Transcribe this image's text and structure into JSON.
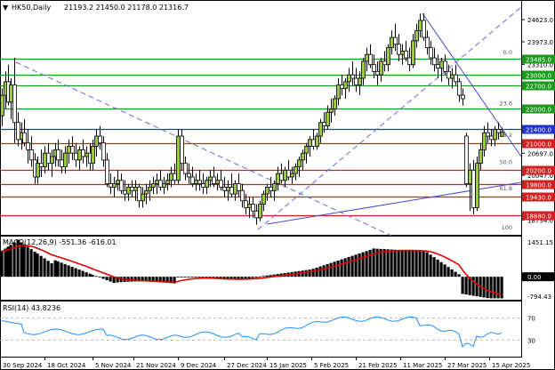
{
  "header": {
    "symbol": "HK50,Daily",
    "ohlc": "21193.2 21450.0 21178.0 21316.7"
  },
  "chart_data": {
    "type": "candlestick",
    "price_axis": {
      "min": 18300,
      "max": 25200,
      "ticks": [
        "24623.0",
        "23973.0",
        "23310.0",
        "22660.0",
        "21997.0",
        "21347.0",
        "20697.0",
        "20047.0",
        "19384.0",
        "18734.0"
      ]
    },
    "date_axis": {
      "labels": [
        "30 Sep 2024",
        "18 Oct 2024",
        "5 Nov 2024",
        "21 Nov 2024",
        "9 Dec 2024",
        "27 Dec 2024",
        "15 Jan 2025",
        "5 Feb 2025",
        "21 Feb 2025",
        "11 Mar 2025",
        "27 Mar 2025",
        "15 Apr 2025"
      ]
    },
    "horizontal_levels": [
      {
        "price": 23485.0,
        "label": "23485.0",
        "color": "#1a9a1a"
      },
      {
        "price": 23000.0,
        "label": "23000.0",
        "color": "#1a9a1a"
      },
      {
        "price": 22700.0,
        "label": "22700.0",
        "color": "#1a9a1a"
      },
      {
        "price": 22000.0,
        "label": "22000.0",
        "color": "#1a9a1a"
      },
      {
        "price": 21400.0,
        "label": "21400.0",
        "color": "#2233cc"
      },
      {
        "price": 21000.0,
        "label": "21000.0",
        "color": "#d21e1e"
      },
      {
        "price": 20200.0,
        "label": "20200.0",
        "color": "#d21e1e"
      },
      {
        "price": 19800.0,
        "label": "19800.0",
        "color": "#d21e1e"
      },
      {
        "price": 19430.0,
        "label": "19430.0",
        "color": "#d21e1e"
      },
      {
        "price": 18880.0,
        "label": "18880.0",
        "color": "#d21e1e"
      }
    ],
    "fib_levels": [
      {
        "price": 23550,
        "label": "0.0"
      },
      {
        "price": 22050,
        "label": "23.6"
      },
      {
        "price": 21120,
        "label": "38.2"
      },
      {
        "price": 20330,
        "label": "50.0"
      },
      {
        "price": 19560,
        "label": "61.8"
      },
      {
        "price": 18400,
        "label": "100"
      }
    ],
    "candles": [
      [
        2,
        21800,
        22600,
        21500,
        22400
      ],
      [
        6,
        22400,
        23100,
        22000,
        22800
      ],
      [
        9,
        22800,
        23300,
        22100,
        22200
      ],
      [
        12,
        22200,
        22900,
        21700,
        22700
      ],
      [
        16,
        22700,
        23500,
        21000,
        21600
      ],
      [
        20,
        21600,
        21900,
        20900,
        21100
      ],
      [
        24,
        21100,
        21600,
        20800,
        21300
      ],
      [
        27,
        21300,
        21700,
        20900,
        21000
      ],
      [
        31,
        21000,
        21400,
        20400,
        20800
      ],
      [
        35,
        20800,
        21200,
        20300,
        20500
      ],
      [
        39,
        20500,
        20700,
        19800,
        20000
      ],
      [
        42,
        20000,
        20600,
        19800,
        20400
      ],
      [
        46,
        20400,
        20800,
        20000,
        20300
      ],
      [
        50,
        20300,
        20900,
        20100,
        20700
      ],
      [
        54,
        20700,
        21000,
        20200,
        20400
      ],
      [
        58,
        20400,
        20800,
        20000,
        20600
      ],
      [
        62,
        20600,
        21000,
        20300,
        20800
      ],
      [
        65,
        20800,
        21100,
        20300,
        20500
      ],
      [
        69,
        20500,
        20800,
        20100,
        20300
      ],
      [
        73,
        20300,
        20900,
        20100,
        20700
      ],
      [
        77,
        20700,
        21100,
        20400,
        20900
      ],
      [
        81,
        20900,
        21200,
        20500,
        20700
      ],
      [
        85,
        20700,
        21000,
        20300,
        20500
      ],
      [
        89,
        20500,
        20900,
        20200,
        20800
      ],
      [
        93,
        20800,
        21100,
        20400,
        20600
      ],
      [
        97,
        20600,
        20900,
        20300,
        20700
      ],
      [
        101,
        20700,
        21000,
        20200,
        20400
      ],
      [
        104,
        20400,
        21100,
        20200,
        20900
      ],
      [
        108,
        20900,
        21400,
        20600,
        21200
      ],
      [
        112,
        21200,
        21500,
        20800,
        21000
      ],
      [
        116,
        21000,
        21200,
        20300,
        20500
      ],
      [
        120,
        20500,
        20700,
        19700,
        19800
      ],
      [
        124,
        19800,
        20100,
        19500,
        19700
      ],
      [
        128,
        19700,
        20000,
        19400,
        19800
      ],
      [
        132,
        19800,
        20200,
        19600,
        19900
      ],
      [
        136,
        19900,
        20100,
        19500,
        19600
      ],
      [
        140,
        19600,
        19900,
        19300,
        19500
      ],
      [
        144,
        19500,
        19800,
        19300,
        19700
      ],
      [
        148,
        19700,
        19900,
        19400,
        19600
      ],
      [
        152,
        19600,
        19900,
        19300,
        19700
      ],
      [
        156,
        19700,
        19800,
        19100,
        19300
      ],
      [
        160,
        19300,
        19700,
        19100,
        19500
      ],
      [
        164,
        19500,
        19800,
        19200,
        19600
      ],
      [
        168,
        19600,
        19900,
        19300,
        19700
      ],
      [
        172,
        19700,
        20000,
        19500,
        19800
      ],
      [
        176,
        19800,
        20100,
        19500,
        19900
      ],
      [
        180,
        19900,
        20200,
        19600,
        19700
      ],
      [
        184,
        19700,
        20000,
        19500,
        19800
      ],
      [
        188,
        19800,
        20100,
        19600,
        19900
      ],
      [
        192,
        19900,
        20300,
        19700,
        20100
      ],
      [
        196,
        20100,
        20400,
        19800,
        19900
      ],
      [
        200,
        19900,
        21400,
        19800,
        21200
      ],
      [
        204,
        21200,
        21400,
        20200,
        20400
      ],
      [
        208,
        20400,
        20600,
        19900,
        20100
      ],
      [
        212,
        20100,
        20400,
        19800,
        20000
      ],
      [
        216,
        20000,
        20300,
        19700,
        19800
      ],
      [
        220,
        19800,
        20100,
        19600,
        19900
      ],
      [
        224,
        19900,
        20200,
        19600,
        19800
      ],
      [
        228,
        19800,
        20100,
        19500,
        19700
      ],
      [
        232,
        19700,
        20000,
        19500,
        19900
      ],
      [
        236,
        19900,
        20200,
        19700,
        20000
      ],
      [
        240,
        20000,
        20300,
        19700,
        19800
      ],
      [
        244,
        19800,
        20100,
        19600,
        19900
      ],
      [
        248,
        19900,
        20200,
        19600,
        19700
      ],
      [
        252,
        19700,
        20000,
        19400,
        19600
      ],
      [
        256,
        19600,
        19900,
        19300,
        19700
      ],
      [
        260,
        19700,
        20100,
        19400,
        19500
      ],
      [
        264,
        19500,
        19900,
        19300,
        19800
      ],
      [
        268,
        19800,
        20100,
        19400,
        19600
      ],
      [
        272,
        19600,
        19800,
        19100,
        19300
      ],
      [
        276,
        19300,
        19500,
        18900,
        19100
      ],
      [
        280,
        19100,
        19400,
        18800,
        19200
      ],
      [
        284,
        19200,
        19400,
        18800,
        19000
      ],
      [
        288,
        19000,
        19200,
        18600,
        18800
      ],
      [
        292,
        18800,
        19300,
        18700,
        19200
      ],
      [
        296,
        19200,
        19600,
        19000,
        19500
      ],
      [
        300,
        19500,
        19800,
        19300,
        19700
      ],
      [
        304,
        19700,
        20000,
        19400,
        19600
      ],
      [
        308,
        19600,
        19900,
        19300,
        19800
      ],
      [
        312,
        19800,
        20300,
        19600,
        20100
      ],
      [
        316,
        20100,
        20400,
        19800,
        19900
      ],
      [
        320,
        19900,
        20300,
        19700,
        20200
      ],
      [
        324,
        20200,
        20500,
        19900,
        20000
      ],
      [
        328,
        20000,
        20300,
        19800,
        20100
      ],
      [
        332,
        20100,
        20400,
        19900,
        20300
      ],
      [
        336,
        20300,
        20600,
        20000,
        20500
      ],
      [
        340,
        20500,
        20800,
        20200,
        20700
      ],
      [
        344,
        20700,
        21000,
        20400,
        20900
      ],
      [
        348,
        20900,
        21200,
        20600,
        21100
      ],
      [
        352,
        21100,
        21400,
        20800,
        20900
      ],
      [
        356,
        20900,
        21300,
        20800,
        21200
      ],
      [
        360,
        21200,
        21700,
        21000,
        21600
      ],
      [
        364,
        21600,
        21900,
        21300,
        21500
      ],
      [
        368,
        21500,
        22100,
        21400,
        21900
      ],
      [
        372,
        21900,
        22300,
        21600,
        22000
      ],
      [
        376,
        22000,
        22400,
        21800,
        22300
      ],
      [
        380,
        22300,
        22900,
        22100,
        22700
      ],
      [
        384,
        22700,
        23000,
        22400,
        22600
      ],
      [
        388,
        22600,
        22900,
        22300,
        22800
      ],
      [
        392,
        22800,
        23200,
        22500,
        23000
      ],
      [
        396,
        23000,
        23400,
        22700,
        22900
      ],
      [
        400,
        22900,
        23200,
        22500,
        22700
      ],
      [
        404,
        22700,
        23100,
        22400,
        22900
      ],
      [
        408,
        22900,
        23500,
        22700,
        23400
      ],
      [
        412,
        23400,
        23800,
        23100,
        23600
      ],
      [
        416,
        23600,
        23900,
        23200,
        23300
      ],
      [
        420,
        23300,
        23600,
        22900,
        23100
      ],
      [
        424,
        23100,
        23400,
        22700,
        23000
      ],
      [
        428,
        23000,
        23500,
        22800,
        23400
      ],
      [
        432,
        23400,
        23700,
        23100,
        23300
      ],
      [
        436,
        23300,
        23900,
        23100,
        23800
      ],
      [
        440,
        23800,
        24300,
        23600,
        24100
      ],
      [
        444,
        24100,
        24500,
        23700,
        23900
      ],
      [
        448,
        23900,
        24200,
        23400,
        23600
      ],
      [
        452,
        23600,
        23900,
        23300,
        23700
      ],
      [
        456,
        23700,
        24000,
        23400,
        23500
      ],
      [
        460,
        23500,
        23800,
        23100,
        23300
      ],
      [
        464,
        23300,
        24200,
        23200,
        24000
      ],
      [
        468,
        24000,
        24500,
        23800,
        24300
      ],
      [
        472,
        24300,
        24800,
        24100,
        24600
      ],
      [
        476,
        24600,
        24800,
        24000,
        24100
      ],
      [
        480,
        24100,
        24300,
        23600,
        23800
      ],
      [
        484,
        23800,
        24000,
        23300,
        23500
      ],
      [
        488,
        23500,
        23800,
        23100,
        23300
      ],
      [
        492,
        23300,
        23600,
        22900,
        23200
      ],
      [
        496,
        23200,
        23500,
        22800,
        23400
      ],
      [
        500,
        23400,
        23600,
        23000,
        23100
      ],
      [
        504,
        23100,
        23300,
        22700,
        22900
      ],
      [
        508,
        22900,
        23200,
        22600,
        23000
      ],
      [
        512,
        23000,
        23300,
        22700,
        22800
      ],
      [
        516,
        22800,
        22900,
        22200,
        22400
      ],
      [
        520,
        22400,
        22600,
        22100,
        22300
      ],
      [
        524,
        21200,
        21300,
        19700,
        19800
      ],
      [
        528,
        19800,
        20400,
        19000,
        20200
      ],
      [
        532,
        20200,
        20500,
        18900,
        19100
      ],
      [
        536,
        19100,
        20600,
        19000,
        20400
      ],
      [
        540,
        20400,
        21000,
        20200,
        20800
      ],
      [
        544,
        20800,
        21500,
        20600,
        21300
      ],
      [
        548,
        21300,
        21600,
        21000,
        21200
      ],
      [
        552,
        21200,
        21400,
        20900,
        21100
      ],
      [
        556,
        21100,
        21500,
        20900,
        21400
      ],
      [
        560,
        21400,
        21600,
        21100,
        21300
      ],
      [
        564,
        21193.2,
        21450.0,
        21178.0,
        21316.7
      ]
    ],
    "macd": {
      "label": "MACD(12,26,9) -551.36 -616.01",
      "ticks": [
        "1451.15",
        "0.00",
        "-794.43"
      ],
      "min": -900,
      "max": 1600
    },
    "rsi": {
      "label": "RSI(14) 43.8236",
      "ticks": [
        "70",
        "30"
      ],
      "min": 0,
      "max": 100,
      "levels": [
        70,
        30
      ]
    }
  }
}
